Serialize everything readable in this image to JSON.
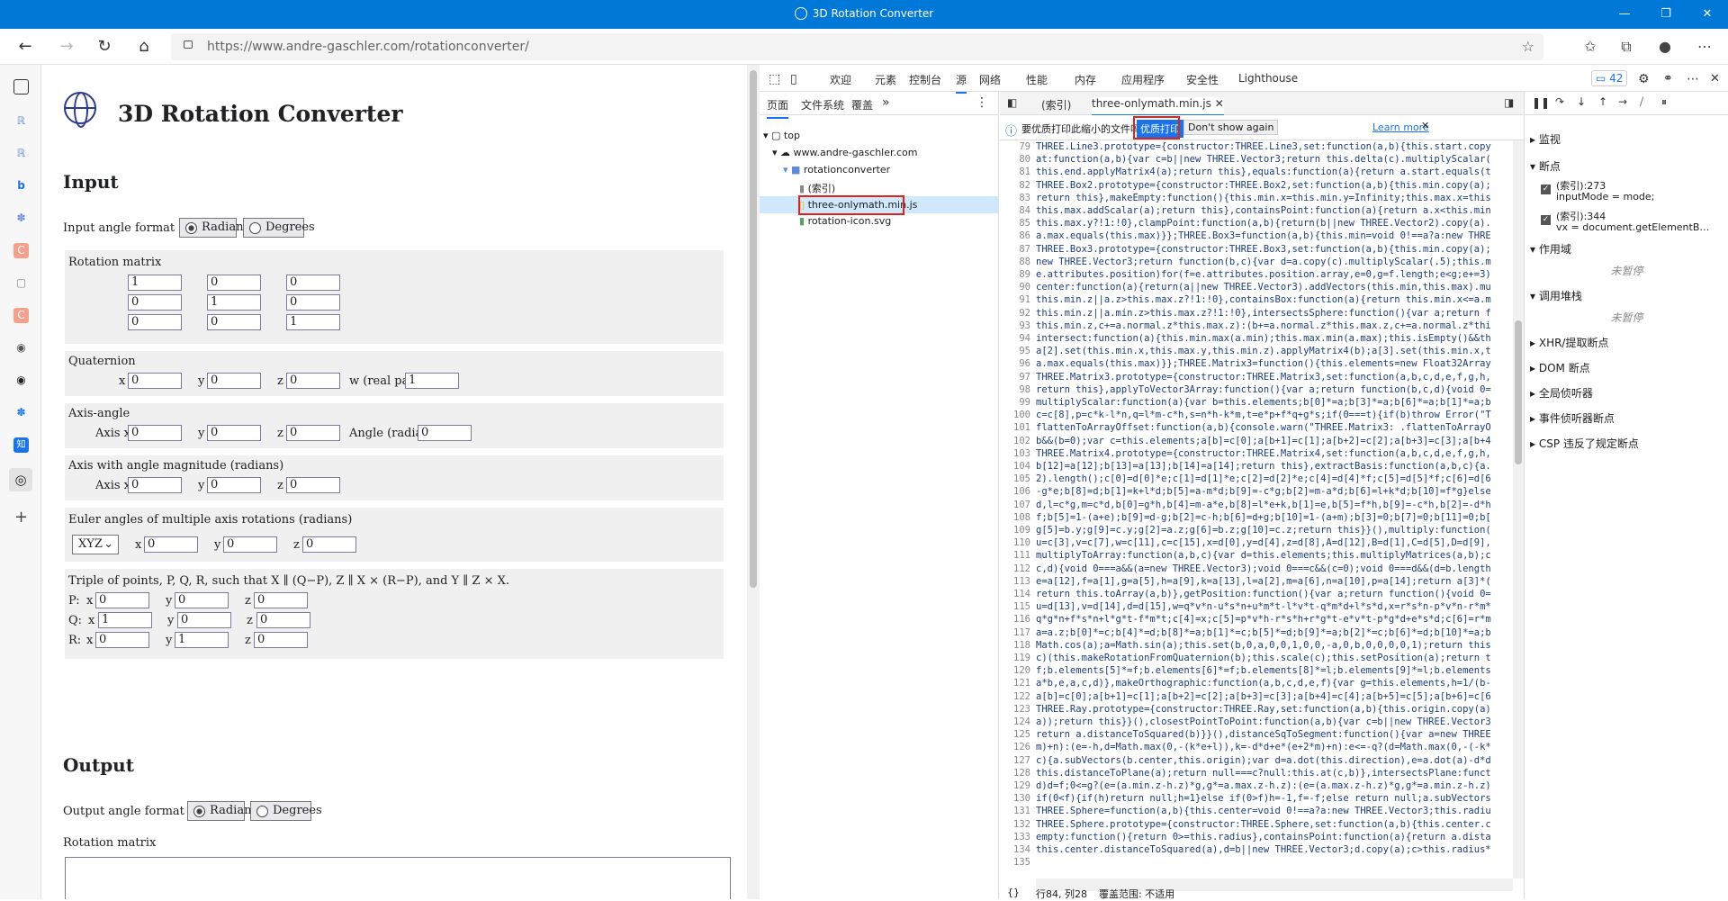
{
  "window": {
    "title": "3D Rotation Converter",
    "minimize": "—",
    "maximize": "❐",
    "close": "✕"
  },
  "address": {
    "url_host": "https://www.andre-gaschler.com",
    "url_path": "/rotationconverter/"
  },
  "page": {
    "title": "3D Rotation Converter",
    "input_heading": "Input",
    "input_format_label": "Input angle format",
    "radians": "Radians",
    "degrees": "Degrees",
    "rotation_matrix_label": "Rotation matrix",
    "matrix": [
      "1",
      "0",
      "0",
      "0",
      "1",
      "0",
      "0",
      "0",
      "1"
    ],
    "quaternion_label": "Quaternion",
    "x": "x",
    "y": "y",
    "z": "z",
    "w_label": "w (real part)",
    "quaternion": {
      "x": "0",
      "y": "0",
      "z": "0",
      "w": "1"
    },
    "axis_angle_label": "Axis-angle",
    "axis_x": "Axis x",
    "angle_radians": "Angle (radians)",
    "axis_angle": {
      "x": "0",
      "y": "0",
      "z": "0",
      "angle": "0"
    },
    "axis_mag_label": "Axis with angle magnitude (radians)",
    "axis_mag": {
      "x": "0",
      "y": "0",
      "z": "0"
    },
    "euler_label": "Euler angles of multiple axis rotations (radians)",
    "euler_order": "XYZ",
    "euler": {
      "x": "0",
      "y": "0",
      "z": "0"
    },
    "triple_label": "Triple of points, P, Q, R, such that X ∥ (Q−P),   Z ∥ X × (R−P),  and Y ∥ Z × X.",
    "p_label": "P:",
    "q_label": "Q:",
    "r_label": "R:",
    "P": {
      "x": "0",
      "y": "0",
      "z": "0"
    },
    "Q": {
      "x": "1",
      "y": "0",
      "z": "0"
    },
    "R": {
      "x": "0",
      "y": "1",
      "z": "0"
    },
    "output_heading": "Output",
    "output_format_label": "Output angle format",
    "output_matrix_label": "Rotation matrix"
  },
  "devtools": {
    "tabs": [
      "欢迎",
      "元素",
      "控制台",
      "源",
      "网络",
      "性能",
      "内存",
      "应用程序",
      "安全性",
      "Lighthouse"
    ],
    "active_tab": "源",
    "issue_count": "42",
    "nav_tabs": {
      "page": "页面",
      "fs": "文件系统",
      "overrides": "覆盖",
      "more": "»"
    },
    "tree": {
      "top": "top",
      "host": "www.andre-gaschler.com",
      "folder": "rotationconverter",
      "index": "(索引)",
      "file1": "three-onlymath.min.js",
      "file2": "rotation-icon.svg"
    },
    "src_tabs": {
      "index": "(索引)",
      "file": "three-onlymath.min.js"
    },
    "infobar": {
      "question": "要优质打印此缩小的文件吗?",
      "pretty": "优质打印",
      "dont": "Don't show again",
      "learn": "Learn more"
    },
    "line_numbers": [
      "79",
      "80",
      "81",
      "82",
      "83",
      "84",
      "85",
      "86",
      "87",
      "88",
      "89",
      "90",
      "91",
      "92",
      "93",
      "94",
      "95",
      "96",
      "97",
      "98",
      "99",
      "100",
      "101",
      "102",
      "103",
      "104",
      "105",
      "106",
      "107",
      "108",
      "109",
      "110",
      "111",
      "112",
      "113",
      "114",
      "115",
      "116",
      "117",
      "118",
      "119",
      "120",
      "121",
      "122",
      "123",
      "124",
      "125",
      "126",
      "127",
      "128",
      "129",
      "130",
      "131",
      "132",
      "133",
      "134",
      "135"
    ],
    "code_lines": [
      "THREE.Line3.prototype={constructor:THREE.Line3,set:function(a,b){this.start.copy",
      "at:function(a,b){var c=b||new THREE.Vector3;return this.delta(c).multiplyScalar(",
      "this.end.applyMatrix4(a);return this},equals:function(a){return a.start.equals(t",
      "THREE.Box2.prototype={constructor:THREE.Box2,set:function(a,b){this.min.copy(a);",
      "return this},makeEmpty:function(){this.min.x=this.min.y=Infinity;this.max.x=this",
      "this.max.addScalar(a);return this},containsPoint:function(a){return a.x<this.min",
      "this.max.y?!1:!0},clampPoint:function(a,b){return(b||new THREE.Vector2).copy(a).",
      "a.max.equals(this.max)}};THREE.Box3=function(a,b){this.min=void 0!==a?a:new THRE",
      "THREE.Box3.prototype={constructor:THREE.Box3,set:function(a,b){this.min.copy(a);",
      "new THREE.Vector3;return function(b,c){var d=a.copy(c).multiplyScalar(.5);this.m",
      "e.attributes.position)for(f=e.attributes.position.array,e=0,g=f.length;e<g;e+=3)",
      "center:function(a){return(a||new THREE.Vector3).addVectors(this.min,this.max).mu",
      "this.min.z||a.z>this.max.z?!1:!0},containsBox:function(a){return this.min.x<=a.m",
      "this.min.z||a.min.z>this.max.z?!1:!0},intersectsSphere:function(){var a;return f",
      "this.min.z,c+=a.normal.z*this.max.z):(b+=a.normal.z*this.max.z,c+=a.normal.z*thi",
      "intersect:function(a){this.min.max(a.min);this.max.min(a.max);this.isEmpty()&&th",
      "a[2].set(this.min.x,this.max.y,this.min.z).applyMatrix4(b);a[3].set(this.min.x,t",
      "a.max.equals(this.max)}};THREE.Matrix3=function(){this.elements=new Float32Array",
      "THREE.Matrix3.prototype={constructor:THREE.Matrix3,set:function(a,b,c,d,e,f,g,h,",
      "return this},applyToVector3Array:function(){var a;return function(b,c,d){void 0=",
      "multiplyScalar:function(a){var b=this.elements;b[0]*=a;b[3]*=a;b[6]*=a;b[1]*=a;b",
      "c=c[8],p=c*k-l*n,q=l*m-c*h,s=n*h-k*m,t=e*p+f*q+g*s;if(0===t){if(b)throw Error(\"T",
      "flattenToArrayOffset:function(a,b){console.warn(\"THREE.Matrix3: .flattenToArrayO",
      "b&&(b=0);var c=this.elements;a[b]=c[0];a[b+1]=c[1];a[b+2]=c[2];a[b+3]=c[3];a[b+4",
      "THREE.Matrix4.prototype={constructor:THREE.Matrix4,set:function(a,b,c,d,e,f,g,h,",
      "b[12]=a[12];b[13]=a[13];b[14]=a[14];return this},extractBasis:function(a,b,c){a.",
      "2).length();c[0]=d[0]*e;c[1]=d[1]*e;c[2]=d[2]*e;c[4]=d[4]*f;c[5]=d[5]*f;c[6]=d[6",
      "-g*e;b[8]=d;b[1]=k+l*d;b[5]=a-m*d;b[9]=-c*g;b[2]=m-a*d;b[6]=l+k*d;b[10]=f*g}else",
      "d,l=c*g,m=c*d,b[0]=g*h,b[4]=m-a*e,b[8]=l*e+k,b[1]=e,b[5]=f*h,b[9]=-c*h,b[2]=-d*h",
      "f;b[5]=1-(a+e);b[9]=d-g;b[2]=c-h;b[6]=d+g;b[10]=1-(a+m);b[3]=0;b[7]=0;b[11]=0;b[",
      "g[5]=b.y;g[9]=c.y;g[2]=a.z;g[6]=b.z;g[10]=c.z;return this}}(),multiply:function(",
      "u=c[3],v=c[7],w=c[11],c=c[15],x=d[0],y=d[4],z=d[8],A=d[12],B=d[1],C=d[5],D=d[9],",
      "multiplyToArray:function(a,b,c){var d=this.elements;this.multiplyMatrices(a,b);c",
      "c,d){void 0===a&&(a=new THREE.Vector3);void 0===c&&(c=0);void 0===d&&(d=b.length",
      "e=a[12],f=a[1],g=a[5],h=a[9],k=a[13],l=a[2],m=a[6],n=a[10],p=a[14];return a[3]*(",
      "return this.toArray(a,b)},getPosition:function(){var a;return function(){void 0=",
      "u=d[13],v=d[14],d=d[15],w=q*v*n-u*s*n+u*m*t-l*v*t-q*m*d+l*s*d,x=r*s*n-p*v*n-r*m*",
      "q*g*n+f*s*n+l*g*t-f*m*t;c[4]=x;c[5]=p*v*h-r*s*h+r*g*t-e*v*t-p*g*d+e*s*d;c[6]=r*m",
      "a=a.z;b[0]*=c;b[4]*=d;b[8]*=a;b[1]*=c;b[5]*=d;b[9]*=a;b[2]*=c;b[6]*=d;b[10]*=a;b",
      "Math.cos(a);a=Math.sin(a);this.set(b,0,a,0,0,1,0,0,-a,0,b,0,0,0,0,1);return this",
      "c)(this.makeRotationFromQuaternion(b);this.scale(c);this.setPosition(a);return t",
      "f;b.elements[5]*=f;b.elements[6]*=f;b.elements[8]*=l;b.elements[9]*=l;b.elements",
      "a*b,e,a,c,d)},makeOrthographic:function(a,b,c,d,e,f){var g=this.elements,h=1/(b-",
      "a[b]=c[0];a[b+1]=c[1];a[b+2]=c[2];a[b+3]=c[3];a[b+4]=c[4];a[b+5]=c[5];a[b+6]=c[6",
      "THREE.Ray.prototype={constructor:THREE.Ray,set:function(a,b){this.origin.copy(a)",
      "a));return this}}(),closestPointToPoint:function(a,b){var c=b||new THREE.Vector3",
      "return a.distanceToSquared(b)}}(),distanceSqToSegment:function(){var a=new THREE",
      "m)+n):(e=-h,d=Math.max(0,-(k*e+l)),k=-d*d+e*(e+2*m)+n):e<=-q?(d=Math.max(0,-(-k*",
      "c){a.subVectors(b.center,this.origin);var d=a.dot(this.direction),e=a.dot(a)-d*d",
      "this.distanceToPlane(a);return null===c?null:this.at(c,b)},intersectsPlane:funct",
      "d)d=f;0<=g?(e=(a.min.z-h.z)*g,g*=a.max.z-h.z):(e=(a.max.z-h.z)*g,g*=a.min.z-h.z)",
      "if(0<f){if(h)return null;h=1}else if(0>f)h=-1,f=-f;else return null;a.subVectors",
      "THREE.Sphere=function(a,b){this.center=void 0!==a?a:new THREE.Vector3;this.radiu",
      "THREE.Sphere.prototype={constructor:THREE.Sphere,set:function(a,b){this.center.c",
      "empty:function(){return 0>=this.radius},containsPoint:function(a){return a.dista",
      "this.center.distanceToSquared(a),d=b||new THREE.Vector3;d.copy(a);c>this.radius*",
      ""
    ],
    "status": {
      "braces": "{}",
      "pos": "行84, 列28",
      "coverage": "覆盖范围: 不适用"
    },
    "debugger": {
      "watch": "监视",
      "breakpoints": "断点",
      "bp1_loc": "(索引):273",
      "bp1_code": "inputMode = mode;",
      "bp2_loc": "(索引):344",
      "bp2_code": "vx = document.getElementB…",
      "scope": "作用域",
      "not_paused": "未暂停",
      "callstack": "调用堆栈",
      "xhr": "XHR/提取断点",
      "dom": "DOM 断点",
      "global": "全局侦听器",
      "event": "事件侦听器断点",
      "csp": "CSP 违反了规定断点"
    }
  }
}
